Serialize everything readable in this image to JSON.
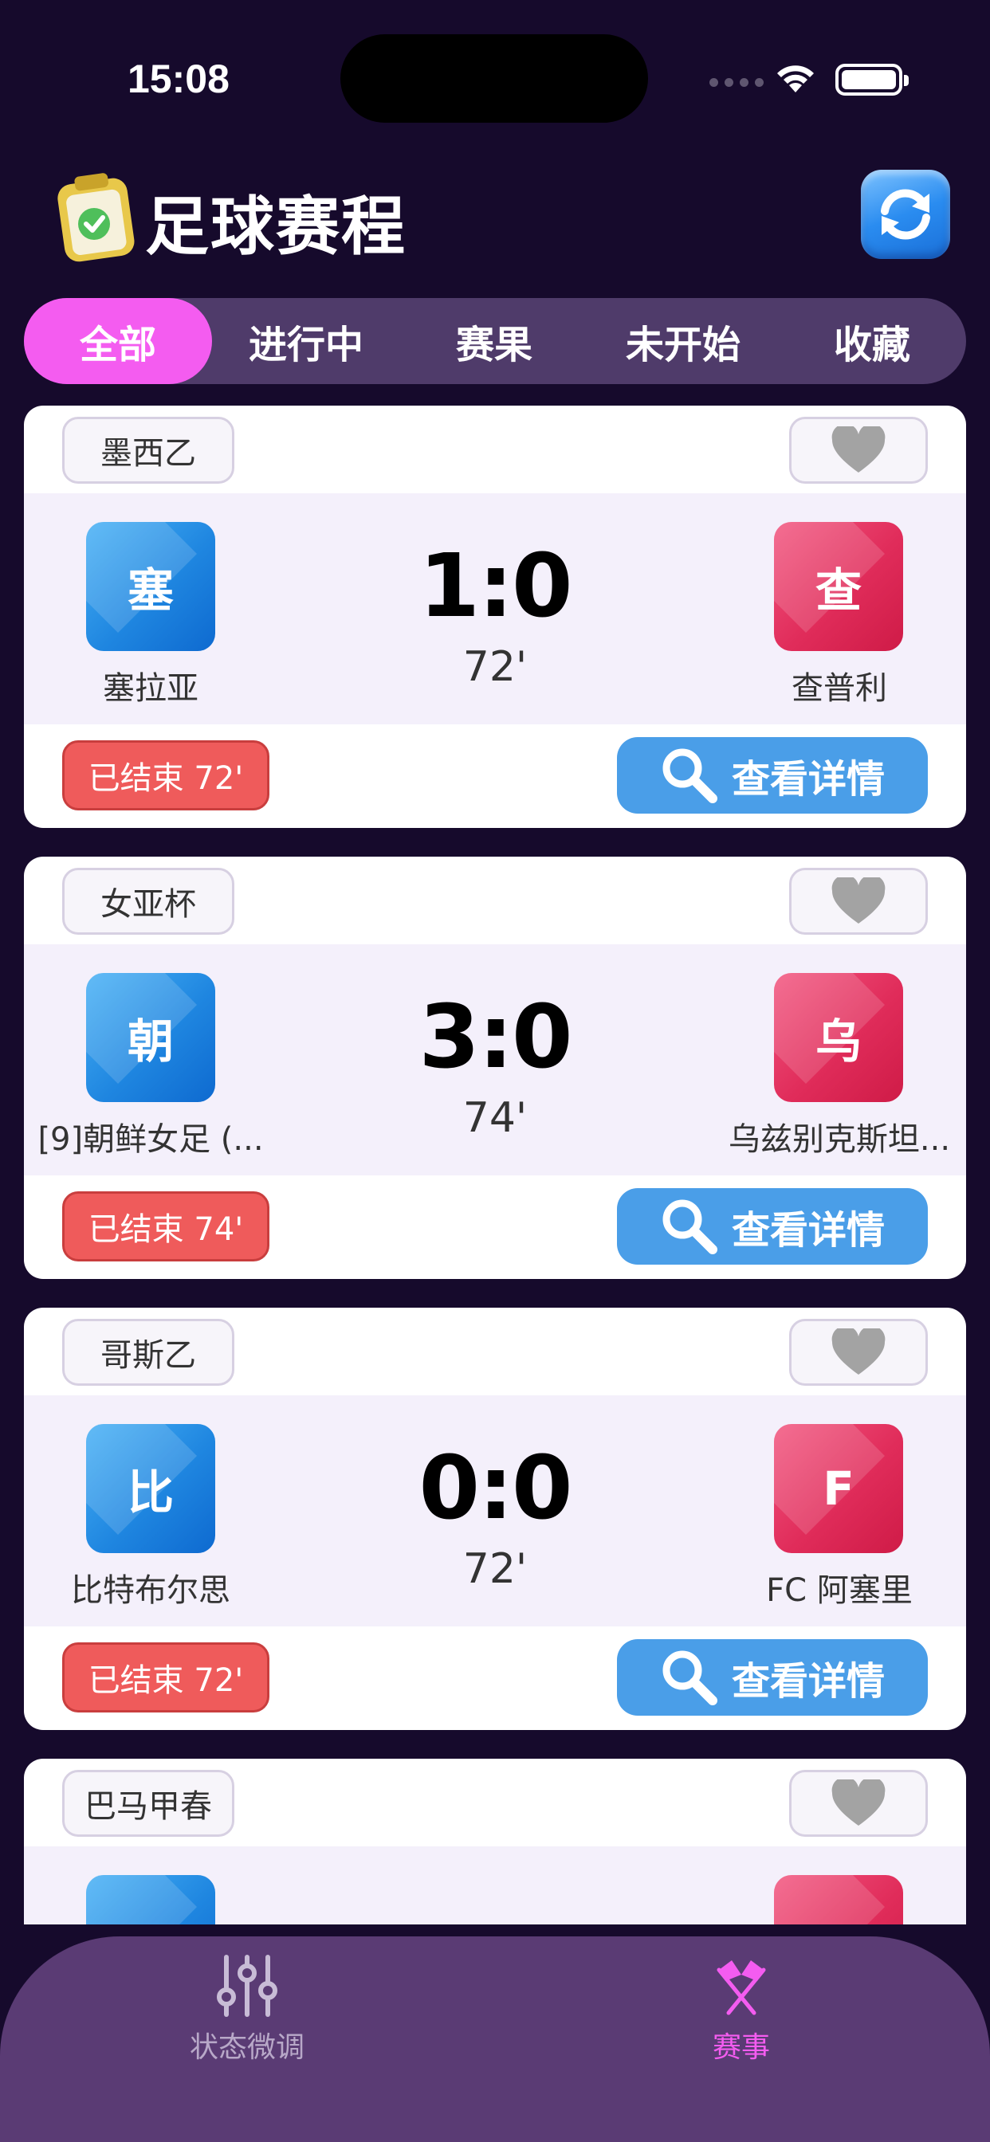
{
  "status_bar": {
    "time": "15:08"
  },
  "header": {
    "title": "足球赛程"
  },
  "tabs": [
    {
      "label": "全部",
      "active": true
    },
    {
      "label": "进行中",
      "active": false
    },
    {
      "label": "赛果",
      "active": false
    },
    {
      "label": "未开始",
      "active": false
    },
    {
      "label": "收藏",
      "active": false
    }
  ],
  "matches": [
    {
      "league": "墨西乙",
      "home": {
        "badge": "塞",
        "name": "塞拉亚"
      },
      "away": {
        "badge": "查",
        "name": "查普利"
      },
      "score": "1:0",
      "minute": "72'",
      "status": "已结束 72'",
      "detail_label": "查看详情"
    },
    {
      "league": "女亚杯",
      "home": {
        "badge": "朝",
        "name": "[9]朝鲜女足 (..."
      },
      "away": {
        "badge": "乌",
        "name": "乌兹别克斯坦..."
      },
      "score": "3:0",
      "minute": "74'",
      "status": "已结束 74'",
      "detail_label": "查看详情"
    },
    {
      "league": "哥斯乙",
      "home": {
        "badge": "比",
        "name": "比特布尔思"
      },
      "away": {
        "badge": "F",
        "name": "FC 阿塞里"
      },
      "score": "0:0",
      "minute": "72'",
      "status": "已结束 72'",
      "detail_label": "查看详情"
    },
    {
      "league": "巴马甲春",
      "home": {
        "badge": "",
        "name": ""
      },
      "away": {
        "badge": "",
        "name": ""
      },
      "score": "",
      "minute": "",
      "status": "",
      "detail_label": ""
    }
  ],
  "bottom_nav": [
    {
      "label": "状态微调",
      "icon": "sliders-icon",
      "active": false
    },
    {
      "label": "赛事",
      "icon": "flags-icon",
      "active": true
    }
  ],
  "colors": {
    "background": "#160a2c",
    "tab_active": "#f45cf0",
    "status_badge": "#ef5b5b",
    "detail_button": "#4a9ee8",
    "home_badge": "#1f86e0",
    "away_badge": "#e02c5a",
    "nav_bar": "#5a3b74"
  }
}
